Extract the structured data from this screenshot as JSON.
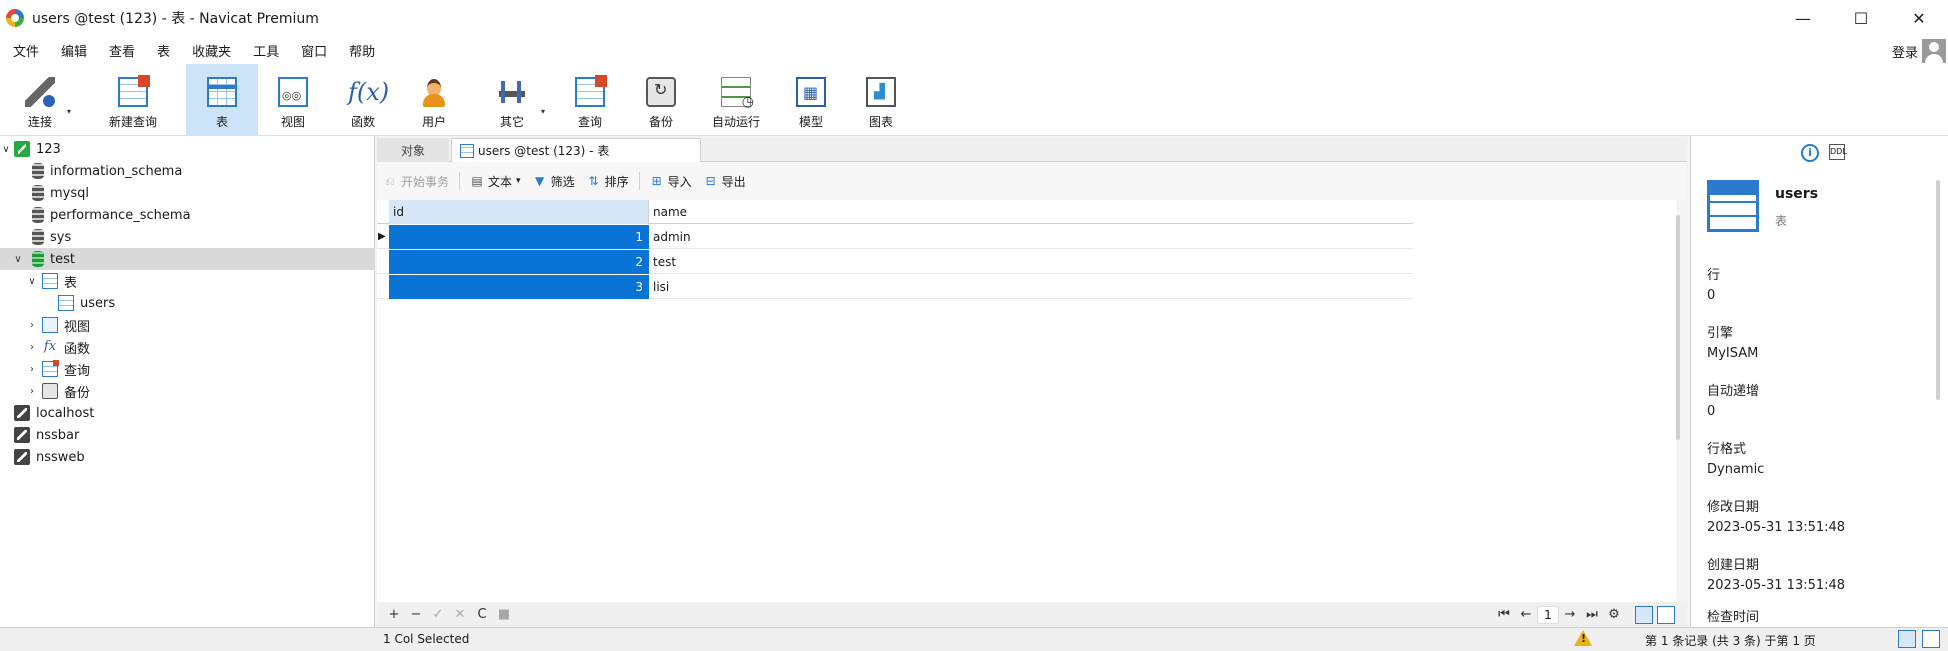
{
  "window": {
    "title": "users @test (123) - 表 - Navicat Premium",
    "controls": [
      "—",
      "☐",
      "✕"
    ]
  },
  "menu": {
    "items": [
      "文件",
      "编辑",
      "查看",
      "表",
      "收藏夹",
      "工具",
      "窗口",
      "帮助"
    ],
    "login": "登录"
  },
  "toolbar": {
    "connect": "连接",
    "new_query": "新建查询",
    "table": "表",
    "view": "视图",
    "function": "函数",
    "user": "用户",
    "other": "其它",
    "query": "查询",
    "backup": "备份",
    "auto_run": "自动运行",
    "model": "模型",
    "chart": "图表",
    "caret": "▾",
    "function_glyph": "f(x)"
  },
  "sidebar": {
    "chev_open": "∨",
    "chev_closed": "›",
    "fx_glyph": "fx",
    "connection": "123",
    "databases": [
      "information_schema",
      "mysql",
      "performance_schema",
      "sys",
      "test"
    ],
    "tables_group": "表",
    "table_item": "users",
    "views_group": "视图",
    "functions_group": "函数",
    "queries_group": "查询",
    "backups_group": "备份",
    "other_connections": [
      "localhost",
      "nssbar",
      "nssweb"
    ]
  },
  "tabs": {
    "objects": "对象",
    "active": "users @test (123) - 表"
  },
  "grid_toolbar": {
    "begin_transaction": "开始事务",
    "text": "文本",
    "text_caret": "▾",
    "filter": "筛选",
    "sort": "排序",
    "import": "导入",
    "export": "导出"
  },
  "grid": {
    "columns": [
      "id",
      "name"
    ],
    "rows": [
      {
        "id": "1",
        "name": "admin"
      },
      {
        "id": "2",
        "name": "test"
      },
      {
        "id": "3",
        "name": "lisi"
      }
    ],
    "row_marker": "▶"
  },
  "grid_nav": {
    "add": "+",
    "delete": "−",
    "apply": "✓",
    "cancel": "✕",
    "refresh": "C",
    "stop": "■",
    "first": "⏮",
    "prev": "←",
    "page": "1",
    "next": "→",
    "last": "⏭",
    "settings": "⚙"
  },
  "status": {
    "left": "1 Col Selected",
    "right": "第 1 条记录 (共 3 条) 于第 1 页"
  },
  "info_panel": {
    "info_icon": "i",
    "ddl_icon": "DDL",
    "name": "users",
    "type": "表",
    "fields": [
      {
        "label": "行",
        "value": "0"
      },
      {
        "label": "引擎",
        "value": "MyISAM"
      },
      {
        "label": "自动递增",
        "value": "0"
      },
      {
        "label": "行格式",
        "value": "Dynamic"
      },
      {
        "label": "修改日期",
        "value": "2023-05-31 13:51:48"
      },
      {
        "label": "创建日期",
        "value": "2023-05-31 13:51:48"
      },
      {
        "label": "检查时间",
        "value": ""
      }
    ]
  }
}
